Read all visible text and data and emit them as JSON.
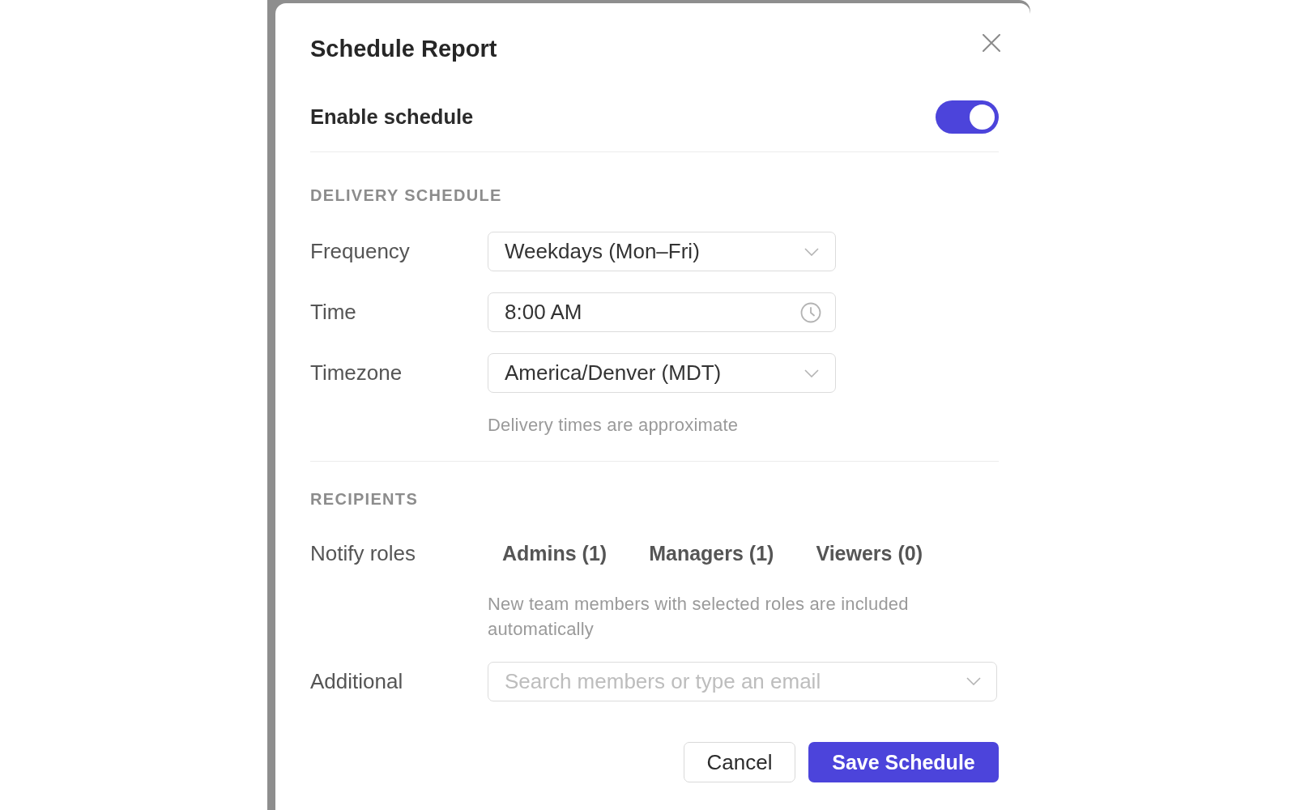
{
  "dialog": {
    "title": "Schedule Report"
  },
  "enable": {
    "label": "Enable schedule",
    "on": true
  },
  "delivery": {
    "heading": "DELIVERY SCHEDULE",
    "fields": [
      {
        "label": "Frequency",
        "kind": "select",
        "value": "Weekdays (Mon–Fri)"
      },
      {
        "label": "Time",
        "kind": "time",
        "value": "8:00 AM"
      },
      {
        "label": "Timezone",
        "kind": "select",
        "value": "America/Denver (MDT)"
      }
    ],
    "hint": "Delivery times are approximate"
  },
  "recipients": {
    "heading": "RECIPIENTS",
    "roles_label": "Notify roles",
    "roles": [
      "Admins (1)",
      "Managers (1)",
      "Viewers (0)"
    ],
    "hint": "New team members with selected roles are included automatically",
    "additional": {
      "label": "Additional",
      "placeholder": "Search members or type an email"
    }
  },
  "buttons": [
    {
      "label": "Cancel",
      "kind": "secondary"
    },
    {
      "label": "Save Schedule",
      "kind": "primary"
    }
  ]
}
